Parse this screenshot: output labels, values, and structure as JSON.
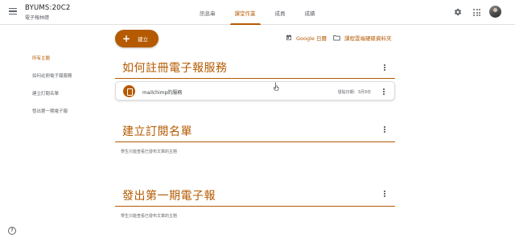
{
  "header": {
    "class_title": "BYUMS:20C2",
    "class_subtitle": "電子報林礎",
    "tabs": [
      {
        "label": "訊息串",
        "active": false
      },
      {
        "label": "課堂作業",
        "active": true
      },
      {
        "label": "成員",
        "active": false
      },
      {
        "label": "成績",
        "active": false
      }
    ],
    "icons": [
      "menu-icon",
      "gear-icon",
      "apps-icon",
      "avatar"
    ]
  },
  "toolbar": {
    "create_label": "建立",
    "calendar_label": "Google 日曆",
    "drive_label": "課程雲端硬碟資料夾"
  },
  "sidebar": {
    "items": [
      {
        "label": "所有主題",
        "active": true
      },
      {
        "label": "如何註冊電子報服務",
        "active": false
      },
      {
        "label": "建立訂閱名單",
        "active": false
      },
      {
        "label": "發出第一期電子報",
        "active": false
      }
    ]
  },
  "topics": [
    {
      "title": "如何註冊電子報服務",
      "assignment": {
        "title": "mailchimp的服務",
        "due": "發貼日期：3月9日"
      }
    },
    {
      "title": "建立訂閱名單",
      "empty_note": "學生只能查看已發布文章的主題"
    },
    {
      "title": "發出第一期電子報",
      "empty_note": "學生只能查看已發布文章的主題"
    }
  ],
  "colors": {
    "accent": "#b55a00",
    "text": "#3c4043",
    "muted": "#5f6368",
    "divider": "#e0e0e0"
  }
}
